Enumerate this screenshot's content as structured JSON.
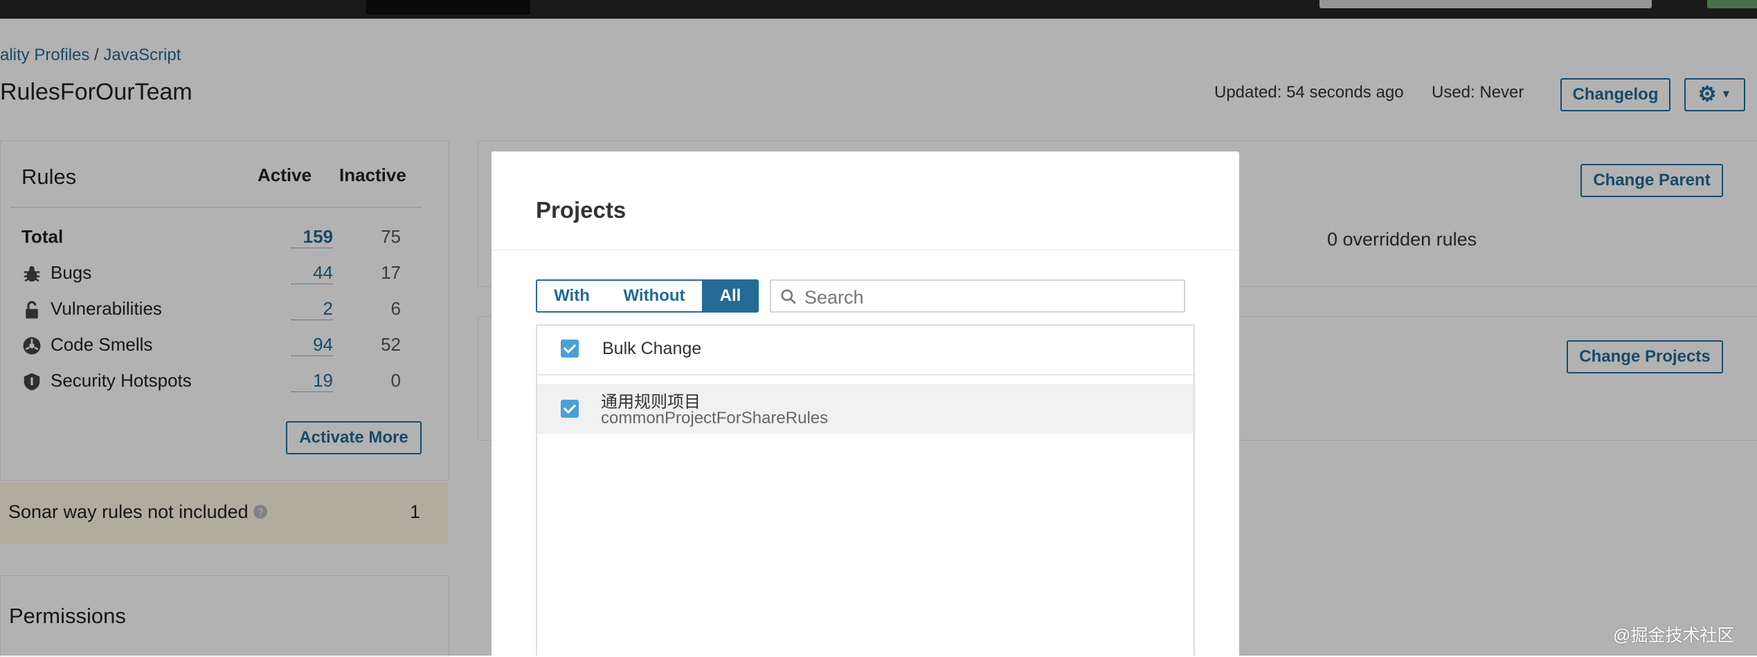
{
  "breadcrumb": {
    "parent": "ality Profiles",
    "separator": "/",
    "current": "JavaScript"
  },
  "profile": {
    "name": "RulesForOurTeam",
    "updated": "Updated: 54 seconds ago",
    "used": "Used: Never"
  },
  "header_buttons": {
    "changelog": "Changelog"
  },
  "rules": {
    "title": "Rules",
    "col_active": "Active",
    "col_inactive": "Inactive",
    "rows": [
      {
        "label": "Total",
        "active": "159",
        "inactive": "75",
        "icon": ""
      },
      {
        "label": "Bugs",
        "active": "44",
        "inactive": "17",
        "icon": "bug-icon"
      },
      {
        "label": "Vulnerabilities",
        "active": "2",
        "inactive": "6",
        "icon": "lock-icon"
      },
      {
        "label": "Code Smells",
        "active": "94",
        "inactive": "52",
        "icon": "code-smell-icon"
      },
      {
        "label": "Security Hotspots",
        "active": "19",
        "inactive": "0",
        "icon": "shield-icon"
      }
    ],
    "activate_more": "Activate More"
  },
  "sonar_notice": {
    "text": "Sonar way rules not included",
    "count": "1"
  },
  "permissions": {
    "title": "Permissions"
  },
  "inheritance": {
    "change_parent": "Change Parent",
    "overridden": "0 overridden rules"
  },
  "projects_card": {
    "change_projects": "Change Projects"
  },
  "modal": {
    "title": "Projects",
    "filters": {
      "with": "With",
      "without": "Without",
      "all": "All",
      "selected": "All"
    },
    "search_placeholder": "Search",
    "bulk_change": "Bulk Change",
    "items": [
      {
        "name": "通用规则项目",
        "key": "commonProjectForShareRules",
        "checked": true
      }
    ]
  },
  "watermark": "@掘金技术社区",
  "colors": {
    "accent": "#236a97",
    "checkbox": "#4b9fd5",
    "notice": "#fcf8e3"
  }
}
